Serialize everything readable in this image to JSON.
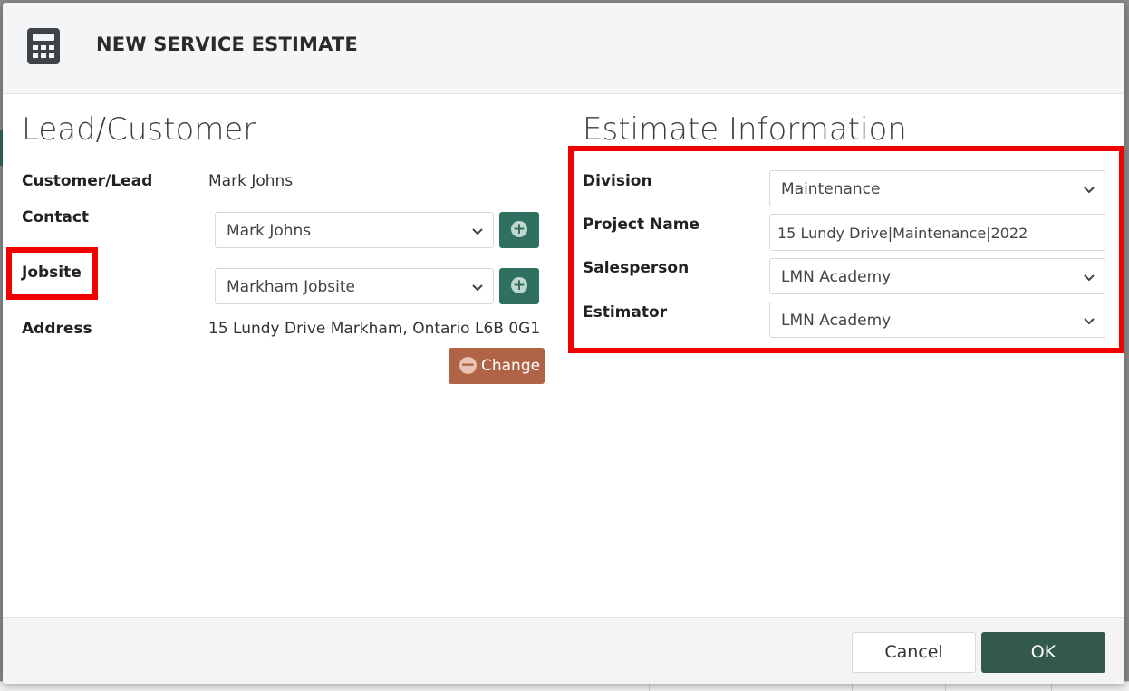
{
  "dialog": {
    "title": "NEW SERVICE ESTIMATE",
    "icon": "calculator-icon"
  },
  "lead_customer": {
    "heading": "Lead/Customer",
    "customer_lead_label": "Customer/Lead",
    "customer_lead_value": "Mark Johns",
    "contact_label": "Contact",
    "contact_selected": "Mark Johns",
    "jobsite_label": "Jobsite",
    "jobsite_selected": "Markham Jobsite",
    "address_label": "Address",
    "address_value": "15 Lundy Drive Markham, Ontario L6B 0G1",
    "change_button": "Change"
  },
  "estimate_info": {
    "heading": "Estimate Information",
    "division_label": "Division",
    "division_selected": "Maintenance",
    "project_name_label": "Project Name",
    "project_name_value": "15 Lundy Drive|Maintenance|2022",
    "salesperson_label": "Salesperson",
    "salesperson_selected": "LMN Academy",
    "estimator_label": "Estimator",
    "estimator_selected": "LMN Academy"
  },
  "footer": {
    "cancel_button": "Cancel",
    "ok_button": "OK"
  },
  "colors": {
    "primary_green": "#33594d",
    "add_button_green": "#2f7060",
    "change_button": "#b06445",
    "highlight_red": "#f00000"
  }
}
